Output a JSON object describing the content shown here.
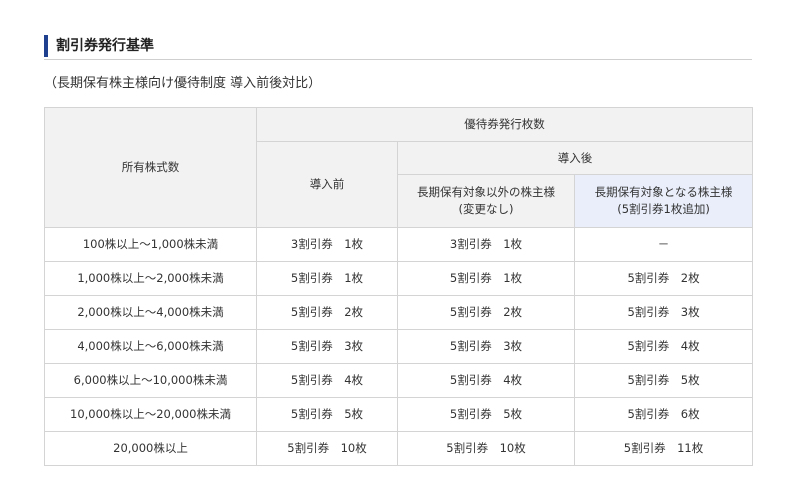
{
  "section": {
    "title": "割引券発行基準",
    "subtitle": "（長期保有株主様向け優待制度 導入前後対比）"
  },
  "table": {
    "header": {
      "shares_col": "所有株式数",
      "issued_group": "優待券発行枚数",
      "before": "導入前",
      "after_group": "導入後",
      "after_non_long_line1": "長期保有対象以外の株主様",
      "after_non_long_line2": "(変更なし)",
      "after_long_line1": "長期保有対象となる株主様",
      "after_long_line2": "(5割引券1枚追加)"
    },
    "rows": [
      {
        "shares": "100株以上～1,000株未満",
        "before": "3割引券　1枚",
        "non_long": "3割引券　1枚",
        "long": "－"
      },
      {
        "shares": "1,000株以上～2,000株未満",
        "before": "5割引券　1枚",
        "non_long": "5割引券　1枚",
        "long": "5割引券　2枚"
      },
      {
        "shares": "2,000株以上～4,000株未満",
        "before": "5割引券　2枚",
        "non_long": "5割引券　2枚",
        "long": "5割引券　3枚"
      },
      {
        "shares": "4,000株以上～6,000株未満",
        "before": "5割引券　3枚",
        "non_long": "5割引券　3枚",
        "long": "5割引券　4枚"
      },
      {
        "shares": "6,000株以上～10,000株未満",
        "before": "5割引券　4枚",
        "non_long": "5割引券　4枚",
        "long": "5割引券　5枚"
      },
      {
        "shares": "10,000株以上～20,000株未満",
        "before": "5割引券　5枚",
        "non_long": "5割引券　5枚",
        "long": "5割引券　6枚"
      },
      {
        "shares": "20,000株以上",
        "before": "5割引券　10枚",
        "non_long": "5割引券　10枚",
        "long": "5割引券　11枚"
      }
    ]
  },
  "colors": {
    "accent_bar": "#1f3f8f",
    "header_bg": "#f2f2f2",
    "highlight_header_bg": "#e9eefa",
    "border": "#d4d4d4"
  }
}
